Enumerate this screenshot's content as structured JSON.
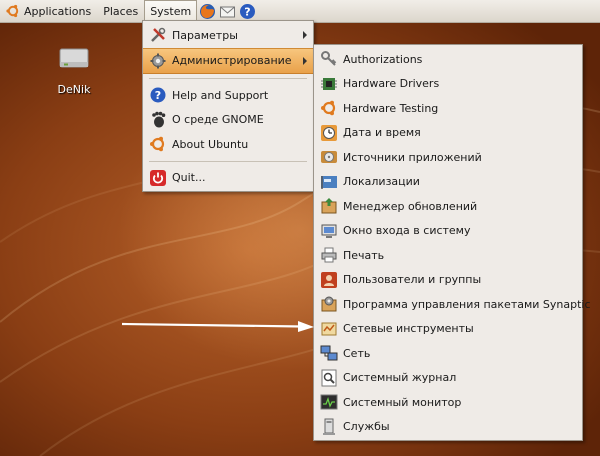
{
  "panel": {
    "applications": "Applications",
    "places": "Places",
    "system": "System"
  },
  "desktop": {
    "icon_label": "DeNik"
  },
  "system_menu": {
    "items": [
      {
        "label": "Параметры",
        "icon": "parameters-icon",
        "submenu": true
      },
      {
        "label": "Администрирование",
        "icon": "administration-icon",
        "submenu": true
      },
      {
        "label": "Help and Support",
        "icon": "help-icon"
      },
      {
        "label": "О среде GNOME",
        "icon": "gnome-icon"
      },
      {
        "label": "About Ubuntu",
        "icon": "ubuntu-icon"
      },
      {
        "label": "Quit...",
        "icon": "quit-icon"
      }
    ]
  },
  "admin_menu": {
    "items": [
      {
        "label": "Authorizations",
        "icon": "keys-icon"
      },
      {
        "label": "Hardware Drivers",
        "icon": "hardware-drivers-icon"
      },
      {
        "label": "Hardware Testing",
        "icon": "hardware-testing-icon"
      },
      {
        "label": "Дата и время",
        "icon": "clock-icon"
      },
      {
        "label": "Источники приложений",
        "icon": "software-sources-icon"
      },
      {
        "label": "Локализации",
        "icon": "localization-icon"
      },
      {
        "label": "Менеджер обновлений",
        "icon": "update-manager-icon"
      },
      {
        "label": "Окно входа в систему",
        "icon": "login-window-icon"
      },
      {
        "label": "Печать",
        "icon": "printer-icon"
      },
      {
        "label": "Пользователи и группы",
        "icon": "users-icon"
      },
      {
        "label": "Программа управления пакетами Synaptic",
        "icon": "synaptic-icon"
      },
      {
        "label": "Сетевые инструменты",
        "icon": "network-tools-icon"
      },
      {
        "label": "Сеть",
        "icon": "network-icon"
      },
      {
        "label": "Системный журнал",
        "icon": "system-log-icon"
      },
      {
        "label": "Системный монитор",
        "icon": "system-monitor-icon"
      },
      {
        "label": "Службы",
        "icon": "services-icon"
      }
    ]
  },
  "colors": {
    "highlight": "#e9a14a",
    "menu_bg": "#efebe7",
    "desktop": "#8a3e14"
  }
}
